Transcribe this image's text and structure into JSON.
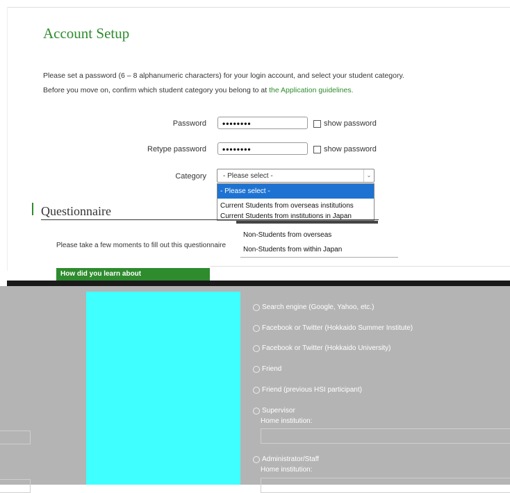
{
  "page": {
    "title": "Account Setup",
    "intro_line1": "Please set a password (6 – 8 alphanumeric characters) for your login account, and select your student category.",
    "intro_line2_text": "Before you move on, confirm which student category you belong to at ",
    "intro_line2_link": "the Application guidelines."
  },
  "form": {
    "password_label": "Password",
    "password_value": "••••••••",
    "retype_label": "Retype password",
    "retype_value": "••••••••",
    "show_password_label": "show password",
    "category_label": "Category",
    "category_selected": "- Please select -",
    "category_options": [
      "- Please select -",
      "Current Students from overseas institutions",
      "Current Students from institutions in Japan"
    ]
  },
  "questionnaire": {
    "title": "Questionnaire",
    "intro": "Please take a few moments to fill out this questionnaire",
    "floating_options": [
      "Non-Students from overseas",
      "Non-Students from within Japan"
    ],
    "question_header": "How did you learn about",
    "answers": [
      "Search engine (Google, Yahoo, etc.)",
      "Facebook or Twitter (Hokkaido Summer Institute)",
      "Facebook or Twitter (Hokkaido University)",
      "Friend",
      "Friend (previous HSI participant)",
      "Supervisor",
      "Administrator/Staff"
    ],
    "home_institution_label": "Home institution:"
  },
  "colors": {
    "accent_green": "#2e8b2e",
    "select_highlight": "#1e73d2",
    "cyan_block": "#40ffff",
    "grey_overlay": "#b4b4b4"
  }
}
